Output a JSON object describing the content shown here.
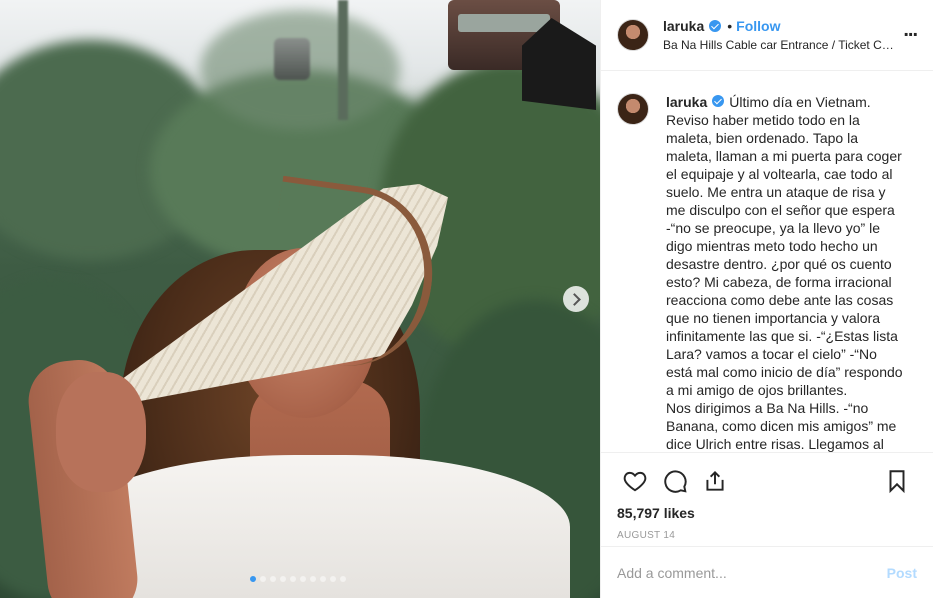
{
  "post": {
    "author": "laruka",
    "follow_label": "Follow",
    "separator": "•",
    "location": "Ba Na Hills Cable car Entrance / Ticket Counte…",
    "more_label": "...",
    "caption": "Último día en Vietnam. Reviso haber metido todo en la maleta, bien ordenado. Tapo la maleta, llaman a mi puerta para coger el equipaje y al voltearla, cae todo al suelo. Me entra un ataque de risa y me disculpo con el señor que espera -“no se preocupe, ya la llevo yo” le digo mientras meto todo hecho un desastre dentro. ¿por qué os cuento esto? Mi cabeza, de forma irracional reacciona como debe ante las cosas que no tienen importancia y valora infinitamente las que si. -“¿Estas lista Lara? vamos a tocar el cielo” -“No está mal como inicio de día” respondo a mi amigo de ojos brillantes.\nNos dirigimos a Ba Na Hills. -“no Banana, como dicen mis amigos” me dice Ulrich entre risas. Llegamos al",
    "likes": "85,797 likes",
    "date": "AUGUST 14",
    "comment_placeholder": "Add a comment...",
    "post_button": "Post"
  },
  "carousel": {
    "total": 10,
    "active_index": 0
  },
  "colors": {
    "link_blue": "#3897f0",
    "post_button_disabled": "#b3dbff",
    "muted_text": "#999999",
    "border": "#efefef"
  },
  "icons": {
    "like": "heart-icon",
    "comment": "comment-bubble-icon",
    "share": "share-icon",
    "save": "bookmark-icon",
    "next": "chevron-right-icon",
    "more": "more-options-icon",
    "verified": "verified-badge-icon"
  }
}
